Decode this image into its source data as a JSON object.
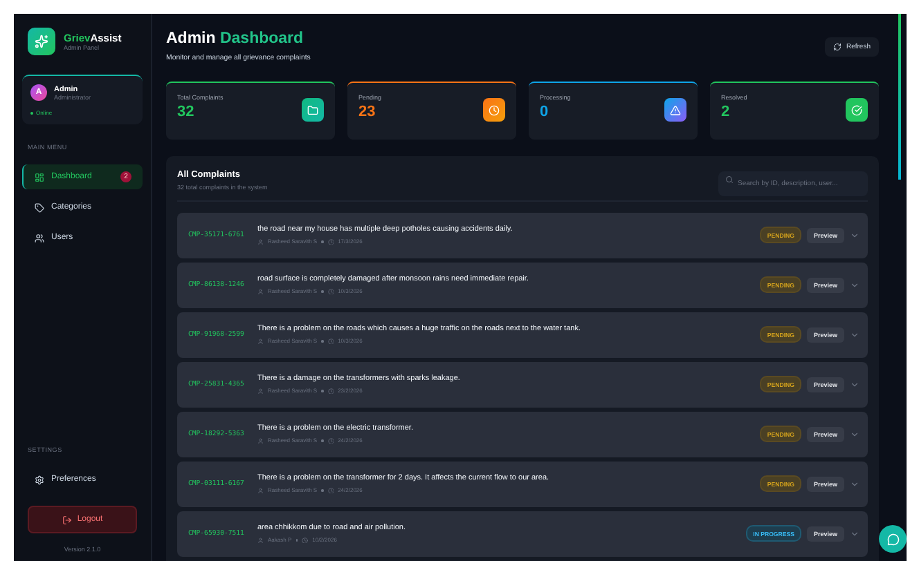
{
  "brand": {
    "name_part_1": "Griev",
    "name_part_2": "Assist",
    "subtitle": "Admin Panel"
  },
  "user": {
    "initial": "A",
    "name": "Admin",
    "role": "Administrator",
    "status": "Online"
  },
  "main_menu": {
    "heading": "MAIN MENU",
    "items": [
      {
        "label": "Dashboard",
        "selected": true,
        "badge": "2"
      },
      {
        "label": "Categories",
        "selected": false
      },
      {
        "label": "Users",
        "selected": false
      }
    ]
  },
  "settings_menu": {
    "heading": "SETTINGS",
    "items": [
      {
        "label": "Preferences"
      }
    ]
  },
  "logout": "Logout",
  "version": "Version 2.1.0",
  "header": {
    "title_part_1": "Admin",
    "title_part_2": "Dashboard",
    "subtitle": "Monitor and manage all grievance complaints",
    "refresh": "Refresh"
  },
  "stats": [
    {
      "label": "Total Complaints",
      "value": "32",
      "color": "#22c55e"
    },
    {
      "label": "Pending",
      "value": "23",
      "color": "#f97316"
    },
    {
      "label": "Processing",
      "value": "0",
      "color": "#0ea5e9"
    },
    {
      "label": "Resolved",
      "value": "2",
      "color": "#22c55e"
    }
  ],
  "complaints": {
    "title": "All Complaints",
    "subtitle": "32 total complaints in the system",
    "search_placeholder": "Search by ID, description, user...",
    "rows": [
      {
        "id": "CMP-35171-6761",
        "text": "the road near my house has multiple deep potholes causing accidents daily.",
        "user": "Rasheed Saravith S",
        "date": "17/3/2026",
        "status": "PENDING",
        "kind": "pending",
        "action": "Preview"
      },
      {
        "id": "CMP-86138-1246",
        "text": "road surface is completely damaged after monsoon rains need immediate repair.",
        "user": "Rasheed Saravith S",
        "date": "10/3/2026",
        "status": "PENDING",
        "kind": "pending",
        "action": "Preview"
      },
      {
        "id": "CMP-91968-2599",
        "text": "There is a problem on the roads which causes a huge traffic on the roads next to the water tank.",
        "user": "Rasheed Saravith S",
        "date": "10/3/2026",
        "status": "PENDING",
        "kind": "pending",
        "action": "Preview"
      },
      {
        "id": "CMP-25831-4365",
        "text": "There is a damage on the transformers with sparks leakage.",
        "user": "Rasheed Saravith S",
        "date": "23/2/2026",
        "status": "PENDING",
        "kind": "pending",
        "action": "Preview"
      },
      {
        "id": "CMP-18292-5363",
        "text": "There is a problem on the electric transformer.",
        "user": "Rasheed Saravith S",
        "date": "24/2/2026",
        "status": "PENDING",
        "kind": "pending",
        "action": "Preview"
      },
      {
        "id": "CMP-03111-6167",
        "text": "There is a problem on the transformer for 2 days. It affects the current flow to our area.",
        "user": "Rasheed Saravith S",
        "date": "24/2/2026",
        "status": "PENDING",
        "kind": "pending",
        "action": "Preview"
      },
      {
        "id": "CMP-65930-7511",
        "text": "area chhikkom due to road and air pollution.",
        "user": "Aakash P",
        "date": "10/2/2026",
        "status": "IN PROGRESS",
        "kind": "progress",
        "action": "Preview"
      }
    ]
  }
}
